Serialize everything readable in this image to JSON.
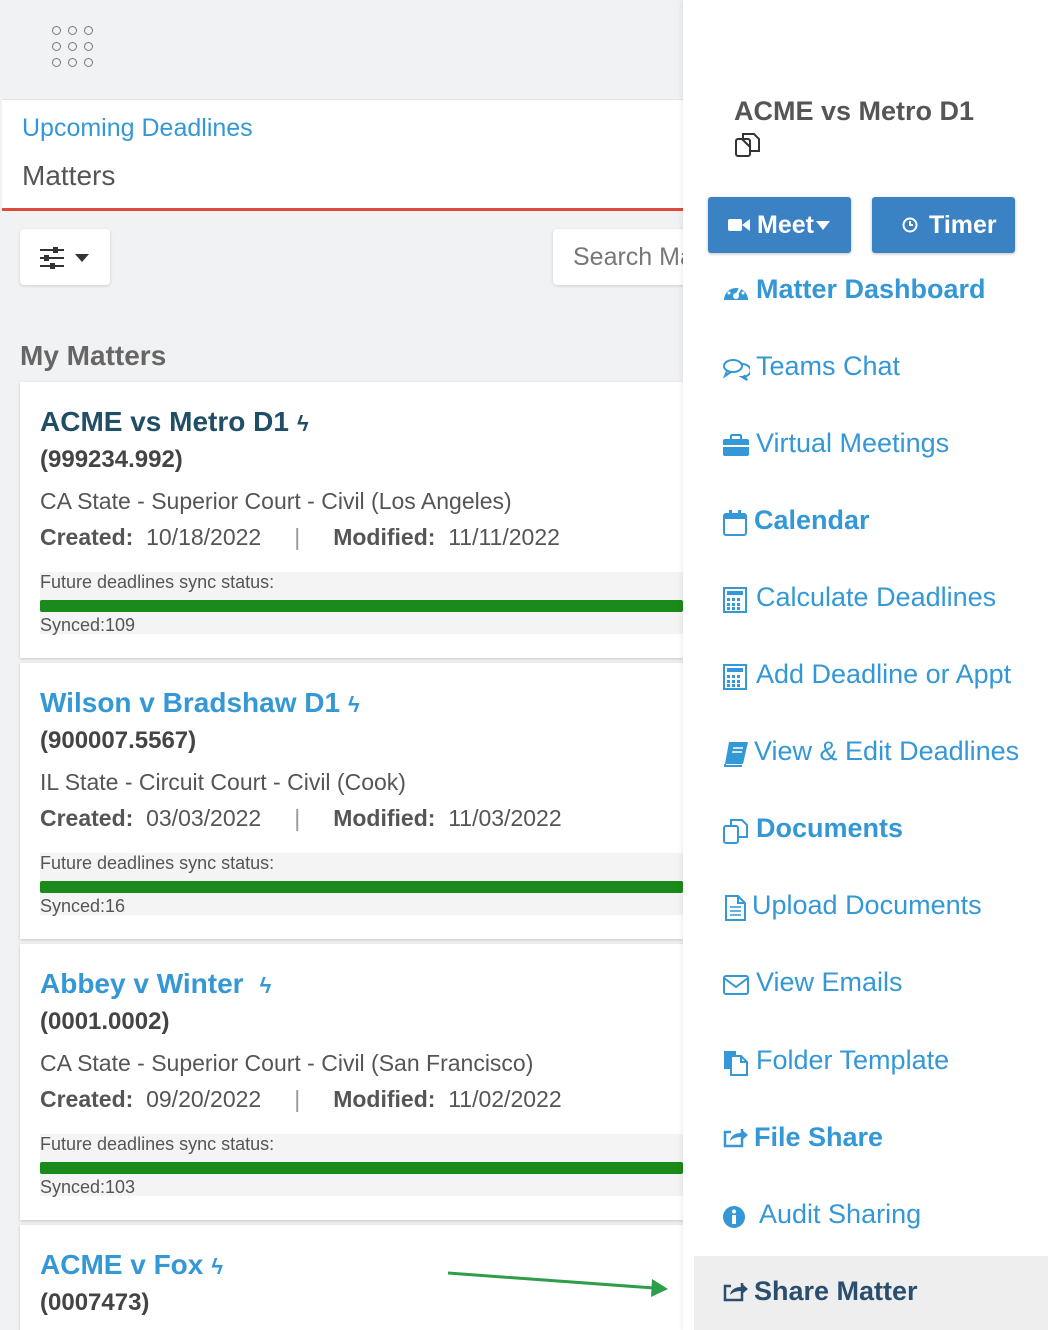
{
  "header": {
    "app_grid_icon": "grid-icon"
  },
  "tabs": {
    "upcoming": "Upcoming Deadlines",
    "matters": "Matters"
  },
  "toolbar": {
    "search_placeholder": "Search Ma"
  },
  "section_title": "My Matters",
  "matters": [
    {
      "title": "ACME vs Metro D1",
      "title_color": "#1f4e66",
      "number": "(999234.992)",
      "court": "CA State - Superior Court - Civil (Los Angeles)",
      "created_label": "Created:",
      "created": "10/18/2022",
      "sep": "|",
      "modified_label": "Modified:",
      "modified": "11/11/2022",
      "sync_label": "Future deadlines sync status:",
      "sync_count": "Synced:109"
    },
    {
      "title": "Wilson v Bradshaw D1",
      "title_color": "#3497d6",
      "number": "(900007.5567)",
      "court": "IL State - Circuit Court - Civil (Cook)",
      "created_label": "Created:",
      "created": "03/03/2022",
      "sep": "|",
      "modified_label": "Modified:",
      "modified": "11/03/2022",
      "sync_label": "Future deadlines sync status:",
      "sync_count": "Synced:16"
    },
    {
      "title": "Abbey v Winter",
      "title_color": "#3497d6",
      "number": "(0001.0002)",
      "court": "CA State - Superior Court - Civil (San Francisco)",
      "created_label": "Created:",
      "created": "09/20/2022",
      "sep": "|",
      "modified_label": "Modified:",
      "modified": "11/02/2022",
      "sync_label": "Future deadlines sync status:",
      "sync_count": "Synced:103"
    },
    {
      "title": "ACME v Fox",
      "title_color": "#3497d6",
      "number": "(0007473)"
    }
  ],
  "panel": {
    "title": "ACME vs Metro D1",
    "meet_label": "Meet",
    "timer_label": "Timer",
    "menu": [
      {
        "label": "Matter Dashboard",
        "icon": "dashboard-icon"
      },
      {
        "label": "Teams Chat",
        "icon": "chat-icon"
      },
      {
        "label": "Virtual Meetings",
        "icon": "briefcase-icon"
      },
      {
        "label": "Calendar",
        "icon": "calendar-icon"
      },
      {
        "label": "Calculate Deadlines",
        "icon": "calculator-icon"
      },
      {
        "label": "Add Deadline or Appt",
        "icon": "calculator-icon"
      },
      {
        "label": "View & Edit Deadlines",
        "icon": "book-icon"
      },
      {
        "label": "Documents",
        "icon": "copy-icon"
      },
      {
        "label": "Upload Documents",
        "icon": "file-icon"
      },
      {
        "label": "View Emails",
        "icon": "envelope-icon"
      },
      {
        "label": "Folder Template",
        "icon": "folder-template-icon"
      },
      {
        "label": "File Share",
        "icon": "share-icon"
      },
      {
        "label": "Audit Sharing",
        "icon": "info-icon"
      },
      {
        "label": "Share Matter",
        "icon": "share-icon"
      }
    ]
  },
  "colors": {
    "accent": "#3497d6",
    "button": "#3a82c4",
    "sync_bar": "#1a8a1a",
    "tab_underline": "#e04a3c",
    "annotation_arrow": "#2e9e4a"
  }
}
